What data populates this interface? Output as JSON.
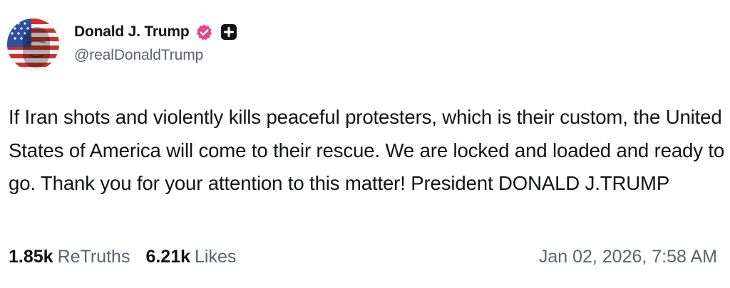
{
  "author": {
    "display_name": "Donald J. Trump",
    "handle": "@realDonaldTrump",
    "verified_icon": "verified-badge-icon",
    "badge_icon": "plus-square-icon",
    "verified_color": "#e8458b"
  },
  "post": {
    "text": "If Iran shots and violently kills peaceful protesters, which is their custom, the United States of America will come to their rescue. We are locked and loaded and ready to go. Thank you for your attention to this matter! President DONALD J.TRUMP"
  },
  "stats": {
    "retruths_count": "1.85k",
    "retruths_label": "ReTruths",
    "likes_count": "6.21k",
    "likes_label": "Likes"
  },
  "timestamp": "Jan 02, 2026, 7:58 AM"
}
